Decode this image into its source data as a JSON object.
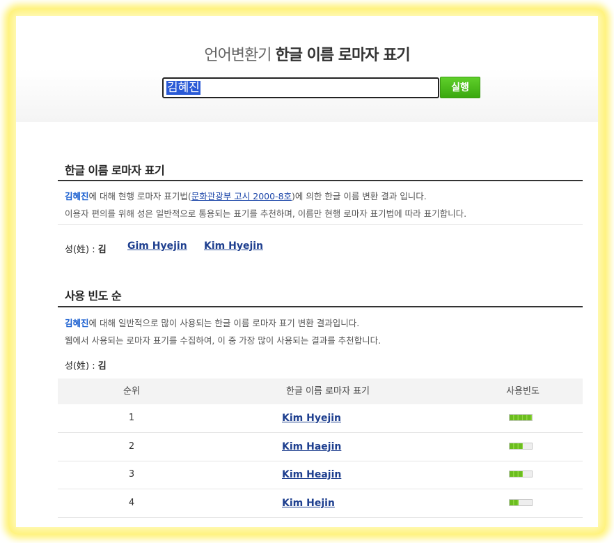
{
  "header": {
    "title_light": "언어변환기",
    "title_bold": "한글 이름 로마자 표기",
    "search_value": "김혜진",
    "run_label": "실행"
  },
  "romaja_section": {
    "title": "한글 이름 로마자 표기",
    "desc1_name": "김혜진",
    "desc1_a": "에 대해 현행 로마자 표기법(",
    "desc1_link": "문화관광부 고시 2000-8호",
    "desc1_b": ")에 의한 한글 이름 변환 결과 입니다.",
    "desc2": "이용자 편의를 위해 성은 일반적으로 통용되는 표기를 추천하며, 이름만 현행 로마자 표기법에 따라 표기합니다.",
    "surname_label": "성(姓) : ",
    "surname_value": "김",
    "results": [
      "Gim Hyejin",
      "Kim Hyejin"
    ]
  },
  "frequency_section": {
    "title": "사용 빈도 순",
    "desc1_name": "김혜진",
    "desc1_rest": "에 대해 일반적으로 많이 사용되는 한글 이름 로마자 표기 변환 결과입니다.",
    "desc2": "웹에서 사용되는 로마자 표기를 수집하여, 이 중 가장 많이 사용되는 결과를 추천합니다.",
    "surname_label": "성(姓) : ",
    "surname_value": "김",
    "columns": [
      "순위",
      "한글 이름 로마자 표기",
      "사용빈도"
    ],
    "rows": [
      {
        "rank": "1",
        "romaja": "Kim Hyejin",
        "frequency": 1.0
      },
      {
        "rank": "2",
        "romaja": "Kim Haejin",
        "frequency": 0.6
      },
      {
        "rank": "3",
        "romaja": "Kim Heajin",
        "frequency": 0.6
      },
      {
        "rank": "4",
        "romaja": "Kim Hejin",
        "frequency": 0.4
      }
    ]
  },
  "colors": {
    "accent_green": "#4cbc1a",
    "link_blue": "#1e3f8f",
    "highlight_glow": "#fff27a"
  }
}
